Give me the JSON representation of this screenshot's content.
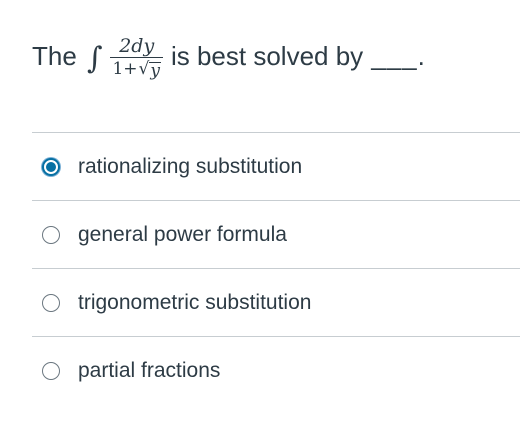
{
  "question": {
    "prefix": "The",
    "integral_symbol": "∫",
    "numerator": "2dy",
    "denominator_start": "1+",
    "radical": "√",
    "radicand": "y",
    "suffix": "is best solved by",
    "blank": "___."
  },
  "options": [
    {
      "label": "rationalizing substitution",
      "selected": true
    },
    {
      "label": "general power formula",
      "selected": false
    },
    {
      "label": "trigonometric substitution",
      "selected": false
    },
    {
      "label": "partial fractions",
      "selected": false
    }
  ],
  "colors": {
    "text": "#2d3b45",
    "selected_radio": "#0770a3",
    "divider": "#c7cdd1"
  }
}
